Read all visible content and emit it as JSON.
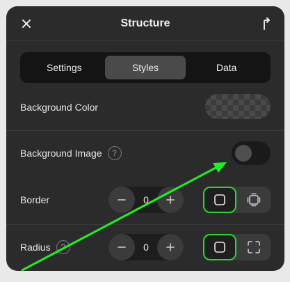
{
  "header": {
    "title": "Structure",
    "close_icon": "close-icon",
    "export_icon": "export-icon"
  },
  "tabs": [
    {
      "label": "Settings",
      "active": false
    },
    {
      "label": "Styles",
      "active": true
    },
    {
      "label": "Data",
      "active": false
    }
  ],
  "properties": {
    "background_color": {
      "label": "Background Color"
    },
    "background_image": {
      "label": "Background Image",
      "help": "?",
      "enabled": false
    },
    "border": {
      "label": "Border",
      "value": "0",
      "mode": "all-sides"
    },
    "radius": {
      "label": "Radius",
      "help": "?",
      "value": "0",
      "mode": "all-corners"
    }
  },
  "colors": {
    "accent_selected": "#2bd52b",
    "annotation_arrow": "#22ee22",
    "panel_bg": "#2b2b2c"
  }
}
